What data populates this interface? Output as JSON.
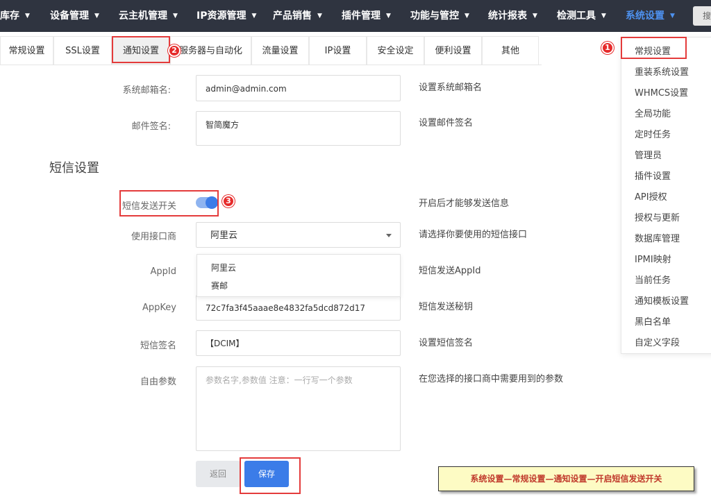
{
  "topnav": {
    "items": [
      "库存",
      "设备管理",
      "云主机管理",
      "IP资源管理",
      "产品销售",
      "插件管理",
      "功能与管控",
      "统计报表",
      "检测工具",
      "系统设置"
    ],
    "search_label": "搜",
    "active_index": 9,
    "active_color": "#4e92f0"
  },
  "tabs": [
    "常规设置",
    "SSL设置",
    "通知设置",
    "服务器与自动化",
    "流量设置",
    "IP设置",
    "安全设定",
    "便利设置",
    "其他"
  ],
  "form": {
    "sys_email_label": "系统邮箱名:",
    "sys_email_value": "admin@admin.com",
    "sys_email_hint": "设置系统邮箱名",
    "mail_sign_label": "邮件签名:",
    "mail_sign_value": "智简魔方",
    "mail_sign_hint": "设置邮件签名"
  },
  "sms": {
    "section_title": "短信设置",
    "switch_label": "短信发送开关",
    "switch_on": true,
    "switch_hint": "开启后才能够发送信息",
    "provider_label": "使用接口商",
    "provider_value": "阿里云",
    "provider_hint": "请选择你要使用的短信接口",
    "provider_options": [
      "阿里云",
      "赛邮"
    ],
    "appid_label": "AppId",
    "appid_hint": "短信发送AppId",
    "appkey_label": "AppKey",
    "appkey_value": "72c7fa3f45aaae8e4832fa5dcd872d17",
    "appkey_hint": "短信发送秘钥",
    "sign_label": "短信签名",
    "sign_value": "【DCIM】",
    "sign_hint": "设置短信签名",
    "params_label": "自由参数",
    "params_placeholder": "参数名字,参数值 注意：一行写一个参数",
    "params_hint": "在您选择的接口商中需要用到的参数"
  },
  "buttons": {
    "back": "返回",
    "save": "保存"
  },
  "menu": [
    "常规设置",
    "重装系统设置",
    "WHMCS设置",
    "全局功能",
    "定时任务",
    "管理员",
    "插件设置",
    "API授权",
    "授权与更新",
    "数据库管理",
    "IPMI映射",
    "当前任务",
    "通知模板设置",
    "黑白名单",
    "自定义字段"
  ],
  "badges": [
    "1",
    "2",
    "3"
  ],
  "note": "系统设置—常规设置—通知设置—开启短信发送开关",
  "colors": {
    "nav_bg": "#2f3440",
    "primary": "#3b7ce8",
    "annotation_red": "#e43b3b"
  }
}
